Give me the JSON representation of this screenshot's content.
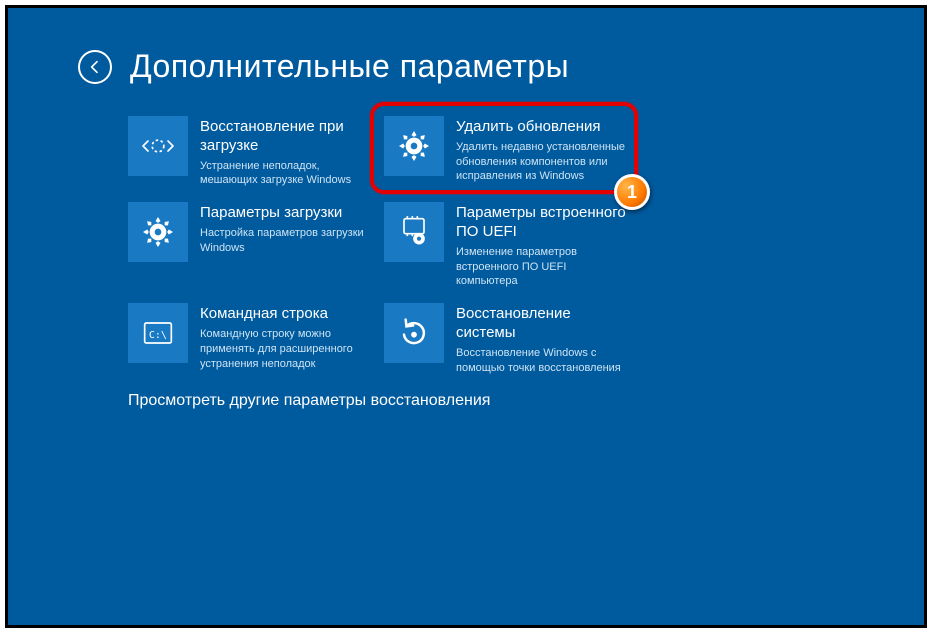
{
  "header": {
    "title": "Дополнительные параметры"
  },
  "tiles": {
    "startup_repair": {
      "title": "Восстановление при загрузке",
      "desc": "Устранение неполадок, мешающих загрузке Windows"
    },
    "uninstall_updates": {
      "title": "Удалить обновления",
      "desc": "Удалить недавно установленные обновления компонентов или исправления из Windows"
    },
    "startup_settings": {
      "title": "Параметры загрузки",
      "desc": "Настройка параметров загрузки Windows"
    },
    "uefi_firmware": {
      "title": "Параметры встроенного ПО UEFI",
      "desc": "Изменение параметров встроенного ПО UEFI компьютера"
    },
    "command_prompt": {
      "title": "Командная строка",
      "desc": "Командную строку можно применять для расширенного устранения неполадок"
    },
    "system_restore": {
      "title": "Восстановление системы",
      "desc": "Восстановление Windows с помощью точки восстановления"
    }
  },
  "more_link": "Просмотреть другие параметры восстановления",
  "annotation": {
    "marker": "1"
  }
}
